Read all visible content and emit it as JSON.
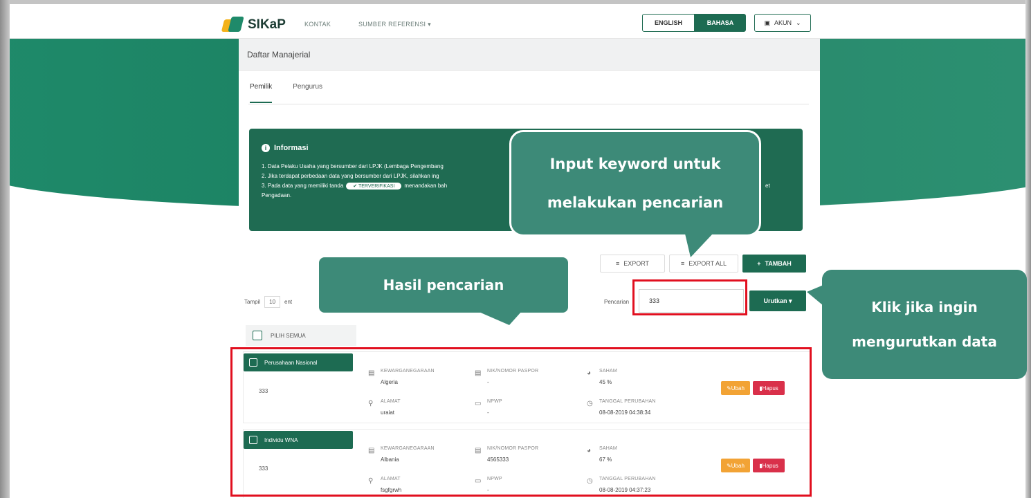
{
  "header": {
    "logo_text": "SIKaP",
    "nav": [
      "KONTAK",
      "SUMBER REFERENSI ▾"
    ],
    "lang_en": "ENGLISH",
    "lang_id": "BAHASA",
    "account": "AKUN"
  },
  "page": {
    "title": "Daftar Manajerial",
    "tabs": [
      "Pemilik",
      "Pengurus"
    ]
  },
  "info": {
    "title": "Informasi",
    "lines": [
      "1. Data Pelaku Usaha yang bersumber dari LPJK (Lembaga Pengembang",
      "2. Jika terdapat perbedaan data yang bersumber dari LPJK, silahkan ing",
      "3. Pada data yang memiliki tanda",
      "Pengadaan."
    ],
    "verified_badge": "✔ TERVERIFIKASI",
    "line3_tail": "menandakan bah",
    "line3_end": "et"
  },
  "toolbar": {
    "export": "EXPORT",
    "export_all": "EXPORT ALL",
    "tambah": "TAMBAH",
    "tampil_label": "Tampil",
    "tampil_value": "10",
    "tampil_suffix": "ent",
    "search_label": "Pencarian",
    "search_value": "333",
    "urutkan": "Urutkan ▾",
    "pilih_semua": "PILIH SEMUA"
  },
  "results": [
    {
      "type": "Perusahaan Nasional",
      "id": "333",
      "kewarganegaraan_label": "KEWARGANEGARAAN",
      "kewarganegaraan": "Algeria",
      "alamat_label": "ALAMAT",
      "alamat": "uraiat",
      "nik_label": "NIK/NOMOR PASPOR",
      "nik": "-",
      "npwp_label": "NPWP",
      "npwp": "-",
      "saham_label": "SAHAM",
      "saham": "45 %",
      "tanggal_label": "TANGGAL PERUBAHAN",
      "tanggal": "08-08-2019 04:38:34",
      "ubah": "Ubah",
      "hapus": "Hapus"
    },
    {
      "type": "Individu WNA",
      "id": "333",
      "kewarganegaraan_label": "KEWARGANEGARAAN",
      "kewarganegaraan": "Albania",
      "alamat_label": "ALAMAT",
      "alamat": "fsgfgrwh",
      "nik_label": "NIK/NOMOR PASPOR",
      "nik": "4565333",
      "npwp_label": "NPWP",
      "npwp": "-",
      "saham_label": "SAHAM",
      "saham": "67 %",
      "tanggal_label": "TANGGAL PERUBAHAN",
      "tanggal": "08-08-2019 04:37:23",
      "ubah": "Ubah",
      "hapus": "Hapus"
    }
  ],
  "callouts": {
    "input_line1": "Input keyword untuk",
    "input_line2": "melakukan pencarian",
    "hasil": "Hasil pencarian",
    "klik_line1": "Klik jika ingin",
    "klik_line2": "mengurutkan data"
  },
  "colors": {
    "brand_green": "#1d6b52",
    "callout_green": "#3d8a78",
    "highlight_red": "#e10f1f",
    "edit_orange": "#f2a335",
    "delete_red": "#d9304a"
  }
}
